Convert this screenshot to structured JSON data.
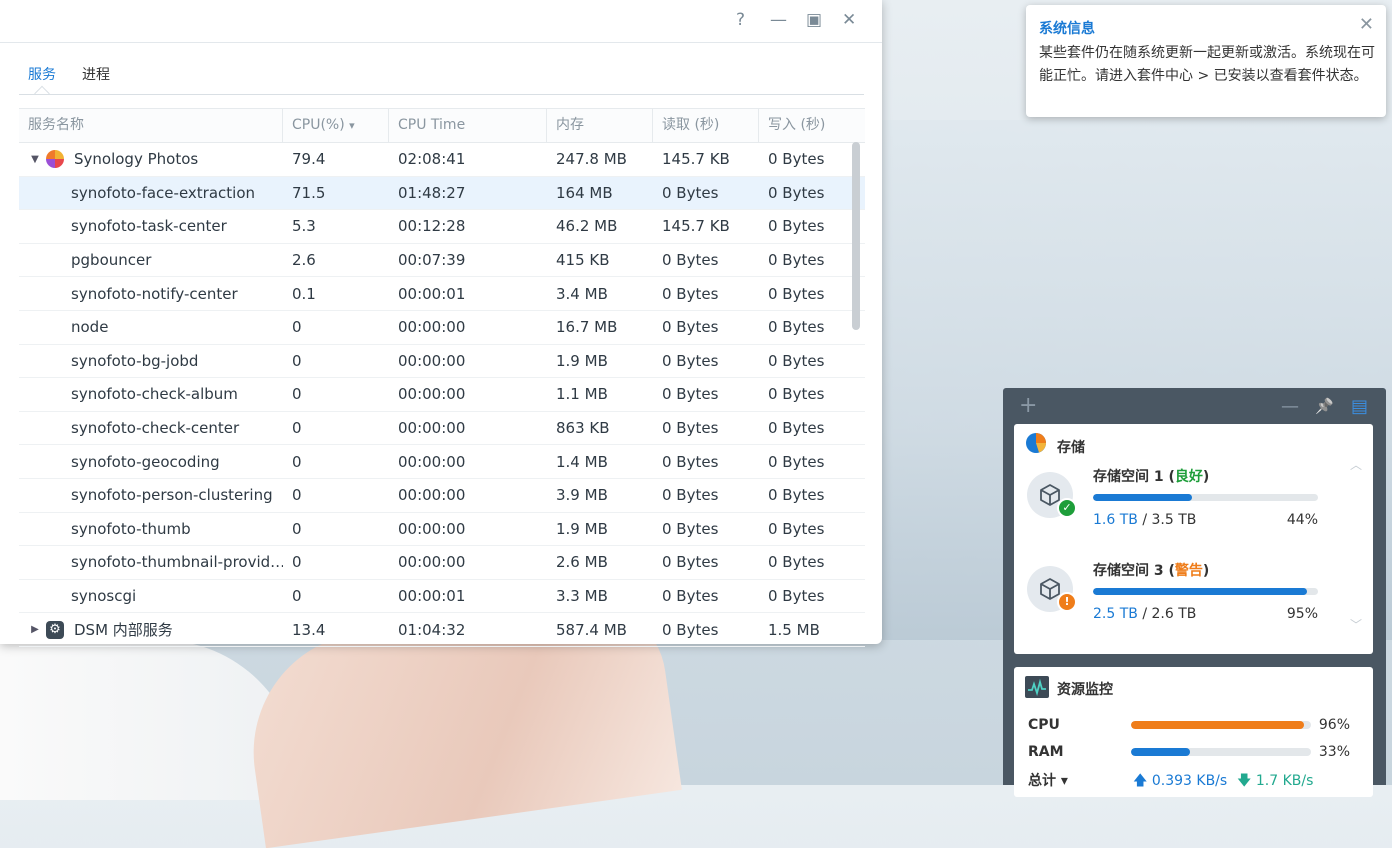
{
  "window": {
    "controls": {
      "help": "?",
      "minimize": "—",
      "maximize": "▣",
      "close": "✕"
    },
    "tabs": [
      {
        "label": "服务",
        "active": true
      },
      {
        "label": "进程",
        "active": false
      }
    ],
    "columns": [
      "服务名称",
      "CPU(%)",
      "CPU Time",
      "内存",
      "读取 (秒)",
      "写入 (秒)"
    ],
    "sort_indicator": "▾",
    "rows": [
      {
        "name": "Synology Photos",
        "cpu": "79.4",
        "time": "02:08:41",
        "mem": "247.8 MB",
        "read": "145.7 KB",
        "write": "0 Bytes",
        "type": "group-expanded",
        "icon": "synology-photos-icon"
      },
      {
        "name": "synofoto-face-extraction",
        "cpu": "71.5",
        "time": "01:48:27",
        "mem": "164 MB",
        "read": "0 Bytes",
        "write": "0 Bytes",
        "type": "child",
        "selected": true
      },
      {
        "name": "synofoto-task-center",
        "cpu": "5.3",
        "time": "00:12:28",
        "mem": "46.2 MB",
        "read": "145.7 KB",
        "write": "0 Bytes",
        "type": "child"
      },
      {
        "name": "pgbouncer",
        "cpu": "2.6",
        "time": "00:07:39",
        "mem": "415 KB",
        "read": "0 Bytes",
        "write": "0 Bytes",
        "type": "child"
      },
      {
        "name": "synofoto-notify-center",
        "cpu": "0.1",
        "time": "00:00:01",
        "mem": "3.4 MB",
        "read": "0 Bytes",
        "write": "0 Bytes",
        "type": "child"
      },
      {
        "name": "node",
        "cpu": "0",
        "time": "00:00:00",
        "mem": "16.7 MB",
        "read": "0 Bytes",
        "write": "0 Bytes",
        "type": "child"
      },
      {
        "name": "synofoto-bg-jobd",
        "cpu": "0",
        "time": "00:00:00",
        "mem": "1.9 MB",
        "read": "0 Bytes",
        "write": "0 Bytes",
        "type": "child"
      },
      {
        "name": "synofoto-check-album",
        "cpu": "0",
        "time": "00:00:00",
        "mem": "1.1 MB",
        "read": "0 Bytes",
        "write": "0 Bytes",
        "type": "child"
      },
      {
        "name": "synofoto-check-center",
        "cpu": "0",
        "time": "00:00:00",
        "mem": "863 KB",
        "read": "0 Bytes",
        "write": "0 Bytes",
        "type": "child"
      },
      {
        "name": "synofoto-geocoding",
        "cpu": "0",
        "time": "00:00:00",
        "mem": "1.4 MB",
        "read": "0 Bytes",
        "write": "0 Bytes",
        "type": "child"
      },
      {
        "name": "synofoto-person-clustering",
        "cpu": "0",
        "time": "00:00:00",
        "mem": "3.9 MB",
        "read": "0 Bytes",
        "write": "0 Bytes",
        "type": "child"
      },
      {
        "name": "synofoto-thumb",
        "cpu": "0",
        "time": "00:00:00",
        "mem": "1.9 MB",
        "read": "0 Bytes",
        "write": "0 Bytes",
        "type": "child"
      },
      {
        "name": "synofoto-thumbnail-provid…",
        "cpu": "0",
        "time": "00:00:00",
        "mem": "2.6 MB",
        "read": "0 Bytes",
        "write": "0 Bytes",
        "type": "child"
      },
      {
        "name": "synoscgi",
        "cpu": "0",
        "time": "00:00:01",
        "mem": "3.3 MB",
        "read": "0 Bytes",
        "write": "0 Bytes",
        "type": "child"
      },
      {
        "name": "DSM 内部服务",
        "cpu": "13.4",
        "time": "01:04:32",
        "mem": "587.4 MB",
        "read": "0 Bytes",
        "write": "1.5 MB",
        "type": "group-collapsed",
        "icon": "gear-icon"
      }
    ]
  },
  "notification": {
    "title": "系统信息",
    "body": "某些套件仍在随系统更新一起更新或激活。系统现在可能正忙。请进入套件中心 > 已安装以查看套件状态。",
    "close": "✕"
  },
  "widgets": {
    "toolbar": {
      "add": "+",
      "minimize": "—",
      "pin": "📌",
      "layout": "▤"
    },
    "storage": {
      "title": "存储",
      "volumes": [
        {
          "name_prefix": "存储空间 1 (",
          "status": "良好",
          "name_suffix": ")",
          "status_color": "#1e9e3a",
          "used": "1.6 TB",
          "sep": " / ",
          "total": "3.5 TB",
          "pct": "44%",
          "fill": 0.44,
          "badge": "✓",
          "badge_color": "#1e9e3a"
        },
        {
          "name_prefix": "存储空间 3 (",
          "status": "警告",
          "name_suffix": ")",
          "status_color": "#ef7d1a",
          "used": "2.5 TB",
          "sep": " / ",
          "total": "2.6 TB",
          "pct": "95%",
          "fill": 0.95,
          "badge": "!",
          "badge_color": "#ef7d1a"
        }
      ]
    },
    "resource": {
      "title": "资源监控",
      "cpu_label": "CPU",
      "cpu_pct": "96%",
      "cpu_fill": 0.96,
      "cpu_color": "#ef7d1a",
      "ram_label": "RAM",
      "ram_pct": "33%",
      "ram_fill": 0.33,
      "ram_color": "#1a7ad4",
      "total_label": "总计 ▾",
      "upload": "0.393 KB/s",
      "download": "1.7 KB/s"
    }
  }
}
